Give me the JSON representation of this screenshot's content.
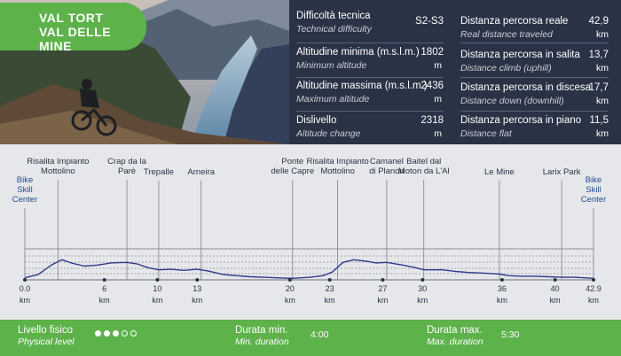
{
  "title": {
    "line1": "VAL TORT",
    "line2": "VAL DELLE MINE"
  },
  "stats": [
    {
      "label": "Difficoltà tecnica",
      "sub": "Technical difficulty",
      "value": "S2-S3",
      "unit": ""
    },
    {
      "label": "Distanza percorsa reale",
      "sub": "Real distance traveled",
      "value": "42,9",
      "unit": "km"
    },
    {
      "label": "Altitudine minima (m.s.l.m.)",
      "sub": "Minimum altitude",
      "value": "1802",
      "unit": "m"
    },
    {
      "label": "Distanza percorsa in salita",
      "sub": "Distance climb (uphill)",
      "value": "13,7",
      "unit": "km"
    },
    {
      "label": "Altitudine massima (m.s.l.m.)",
      "sub": "Maximum altitude",
      "value": "2436",
      "unit": "m"
    },
    {
      "label": "Distanza percorsa in discesa",
      "sub": "Distance down (downhill)",
      "value": "17,7",
      "unit": "km"
    },
    {
      "label": "Dislivello",
      "sub": "Altitude change",
      "value": "2318",
      "unit": "m"
    },
    {
      "label": "Distanza percorsa in piano",
      "sub": "Distance flat",
      "value": "11,5",
      "unit": "km"
    }
  ],
  "profile": {
    "pois": [
      {
        "name": "Bike\nSkill\nCenter",
        "km": 0.0,
        "color": "blue"
      },
      {
        "name": "Risalita Impianto\nMottolino",
        "km": 2.5,
        "color": ""
      },
      {
        "name": "Crap da la\nParè",
        "km": 7.7,
        "color": ""
      },
      {
        "name": "Trepalle",
        "km": 10.1,
        "color": ""
      },
      {
        "name": "Arneira",
        "km": 13.3,
        "color": ""
      },
      {
        "name": "Ponte\ndelle Capre",
        "km": 20.2,
        "color": ""
      },
      {
        "name": "Risalita Impianto\nMottolino",
        "km": 23.6,
        "color": ""
      },
      {
        "name": "Camanel\ndi Planon",
        "km": 27.3,
        "color": ""
      },
      {
        "name": "Baitel dal\nMoton da L'Al",
        "km": 30.1,
        "color": ""
      },
      {
        "name": "Le Mine",
        "km": 35.8,
        "color": ""
      },
      {
        "name": "Larix Park",
        "km": 40.5,
        "color": ""
      },
      {
        "name": "Bike\nSkill\nCenter",
        "km": 42.9,
        "color": "blue"
      }
    ],
    "ticks": [
      {
        "value": "0.0",
        "unit": "km",
        "km": 0.0
      },
      {
        "value": "6",
        "unit": "km",
        "km": 6
      },
      {
        "value": "10",
        "unit": "km",
        "km": 10
      },
      {
        "value": "13",
        "unit": "km",
        "km": 13
      },
      {
        "value": "20",
        "unit": "km",
        "km": 20
      },
      {
        "value": "23",
        "unit": "km",
        "km": 23
      },
      {
        "value": "27",
        "unit": "km",
        "km": 27
      },
      {
        "value": "30",
        "unit": "km",
        "km": 30
      },
      {
        "value": "36",
        "unit": "km",
        "km": 36
      },
      {
        "value": "40",
        "unit": "km",
        "km": 40
      },
      {
        "value": "42.9",
        "unit": "km",
        "km": 42.9
      }
    ],
    "profile_points_km_m": [
      [
        0,
        1840
      ],
      [
        1,
        1900
      ],
      [
        2,
        2080
      ],
      [
        2.8,
        2180
      ],
      [
        3.5,
        2120
      ],
      [
        4.5,
        2060
      ],
      [
        5.5,
        2080
      ],
      [
        6.5,
        2120
      ],
      [
        7.7,
        2130
      ],
      [
        8.5,
        2100
      ],
      [
        9.3,
        2030
      ],
      [
        10.1,
        1990
      ],
      [
        11,
        2000
      ],
      [
        12,
        1980
      ],
      [
        13,
        2000
      ],
      [
        13.8,
        1970
      ],
      [
        15,
        1900
      ],
      [
        16,
        1880
      ],
      [
        17,
        1860
      ],
      [
        18,
        1850
      ],
      [
        19,
        1840
      ],
      [
        20.2,
        1830
      ],
      [
        21.5,
        1850
      ],
      [
        22.5,
        1880
      ],
      [
        23.2,
        1950
      ],
      [
        24,
        2130
      ],
      [
        24.8,
        2180
      ],
      [
        25.8,
        2150
      ],
      [
        26.5,
        2120
      ],
      [
        27.3,
        2130
      ],
      [
        28.5,
        2080
      ],
      [
        29.5,
        2030
      ],
      [
        30.1,
        1990
      ],
      [
        31.5,
        1990
      ],
      [
        32.5,
        1960
      ],
      [
        33.5,
        1940
      ],
      [
        34.5,
        1930
      ],
      [
        35.2,
        1920
      ],
      [
        35.8,
        1910
      ],
      [
        36.5,
        1880
      ],
      [
        37.5,
        1870
      ],
      [
        38.5,
        1870
      ],
      [
        39.5,
        1860
      ],
      [
        40.5,
        1850
      ],
      [
        41.5,
        1850
      ],
      [
        42.9,
        1830
      ]
    ],
    "line_color": "#2d3a8c"
  },
  "footer": {
    "physical_label": "Livello fisico",
    "physical_sub": "Physical level",
    "physical_level": 3,
    "physical_max": 5,
    "min_label": "Durata min.",
    "min_sub": "Min. duration",
    "min_value": "4:00",
    "max_label": "Durata max.",
    "max_sub": "Max. duration",
    "max_value": "5:30"
  },
  "colors": {
    "green": "#5db24a",
    "navy": "#2a3346",
    "profile_bg": "#e6e7ea"
  }
}
